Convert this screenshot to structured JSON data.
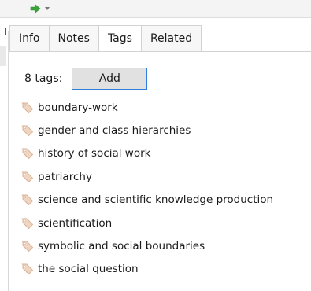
{
  "colors": {
    "accent": "#2d7fd8",
    "tag_icon": "#e3c2a8",
    "arrow_green": "#3aa53a"
  },
  "toolbar": {
    "button_icon": "green-arrow-icon",
    "dropdown_icon": "chevron-down-icon"
  },
  "tabs": [
    {
      "label": "Info"
    },
    {
      "label": "Notes"
    },
    {
      "label": "Tags"
    },
    {
      "label": "Related"
    }
  ],
  "tags_panel": {
    "count_label": "8 tags:",
    "add_label": "Add",
    "items": [
      {
        "label": "boundary-work"
      },
      {
        "label": "gender and class hierarchies"
      },
      {
        "label": "history of social work"
      },
      {
        "label": "patriarchy"
      },
      {
        "label": "science and scientific knowledge production"
      },
      {
        "label": "scientification"
      },
      {
        "label": "symbolic and social boundaries"
      },
      {
        "label": "the social question"
      }
    ]
  }
}
